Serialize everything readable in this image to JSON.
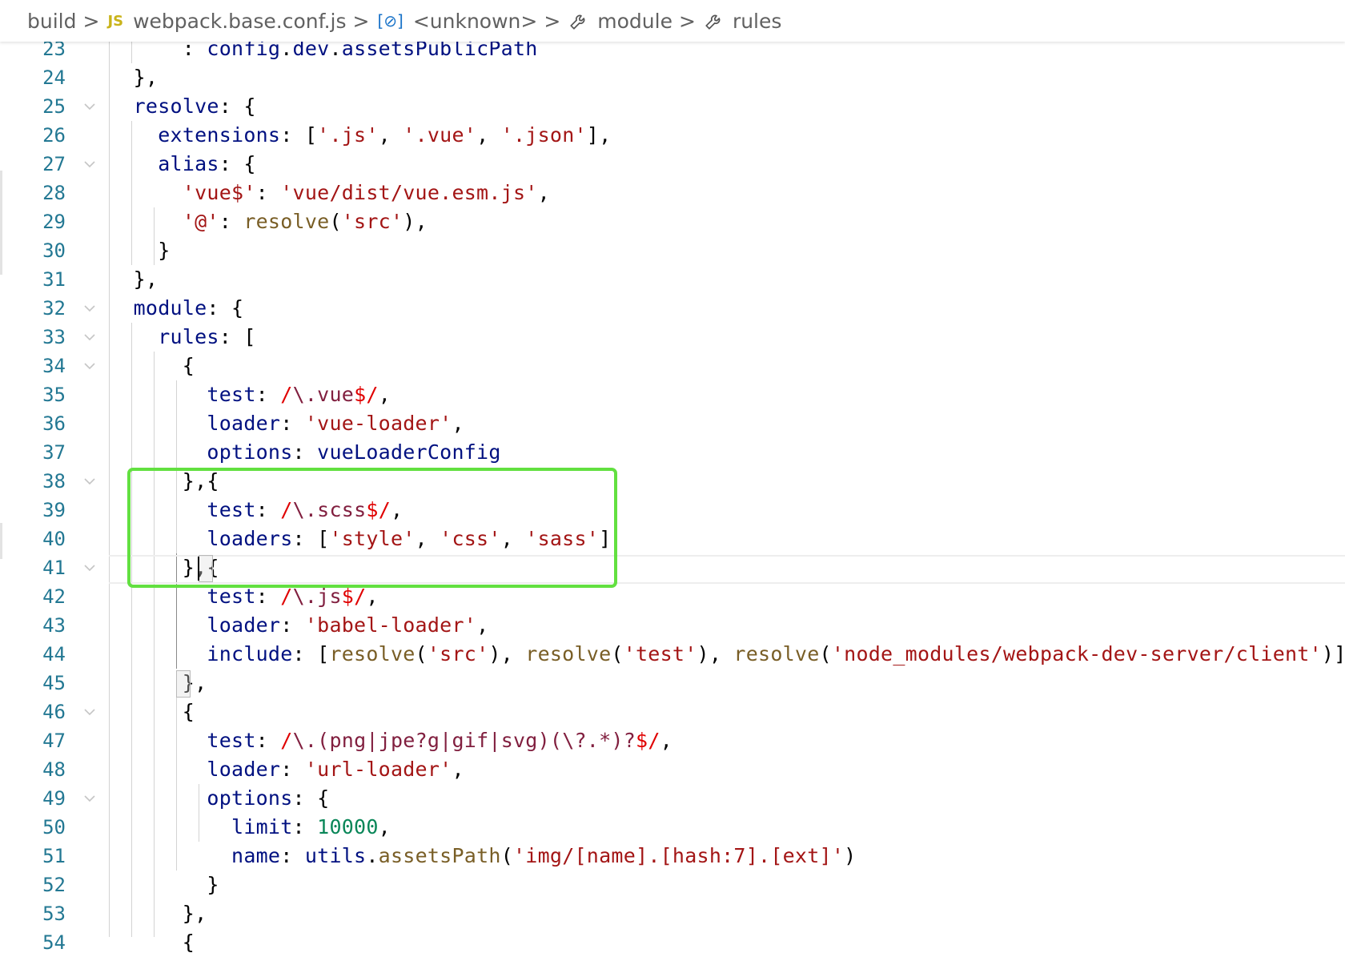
{
  "breadcrumb": {
    "items": [
      {
        "label": "build",
        "icon": ""
      },
      {
        "label": "webpack.base.conf.js",
        "icon": "JS"
      },
      {
        "label": "<unknown>",
        "icon": "symbol-variable"
      },
      {
        "label": "module",
        "icon": "wrench"
      },
      {
        "label": "rules",
        "icon": "wrench"
      }
    ],
    "separator": ">"
  },
  "colors": {
    "highlight_box": "#62e040",
    "line_number": "#237893",
    "keyword": "#001080",
    "string": "#a31515",
    "regex": "#811f3f"
  },
  "editor": {
    "lines": [
      {
        "n": "23",
        "fold": false
      },
      {
        "n": "24",
        "fold": false
      },
      {
        "n": "25",
        "fold": true
      },
      {
        "n": "26",
        "fold": false
      },
      {
        "n": "27",
        "fold": true
      },
      {
        "n": "28",
        "fold": false
      },
      {
        "n": "29",
        "fold": false
      },
      {
        "n": "30",
        "fold": false
      },
      {
        "n": "31",
        "fold": false
      },
      {
        "n": "32",
        "fold": true
      },
      {
        "n": "33",
        "fold": true
      },
      {
        "n": "34",
        "fold": true
      },
      {
        "n": "35",
        "fold": false
      },
      {
        "n": "36",
        "fold": false
      },
      {
        "n": "37",
        "fold": false
      },
      {
        "n": "38",
        "fold": true
      },
      {
        "n": "39",
        "fold": false
      },
      {
        "n": "40",
        "fold": false
      },
      {
        "n": "41",
        "fold": true
      },
      {
        "n": "42",
        "fold": false
      },
      {
        "n": "43",
        "fold": false
      },
      {
        "n": "44",
        "fold": false
      },
      {
        "n": "45",
        "fold": false
      },
      {
        "n": "46",
        "fold": true
      },
      {
        "n": "47",
        "fold": false
      },
      {
        "n": "48",
        "fold": false
      },
      {
        "n": "49",
        "fold": true
      },
      {
        "n": "50",
        "fold": false
      },
      {
        "n": "51",
        "fold": false
      },
      {
        "n": "52",
        "fold": false
      },
      {
        "n": "53",
        "fold": false
      },
      {
        "n": "54",
        "fold": false
      }
    ],
    "code": {
      "l23_a": "      : ",
      "l23_b": "config",
      "l23_c": ".",
      "l23_d": "dev",
      "l23_e": ".",
      "l23_f": "assetsPublicPath",
      "l24": "  },",
      "l25_a": "  ",
      "l25_b": "resolve",
      "l25_c": ": {",
      "l26_a": "    ",
      "l26_b": "extensions",
      "l26_c": ": [",
      "l26_d": "'.js'",
      "l26_e": ", ",
      "l26_f": "'.vue'",
      "l26_g": ", ",
      "l26_h": "'.json'",
      "l26_i": "],",
      "l27_a": "    ",
      "l27_b": "alias",
      "l27_c": ": {",
      "l28_a": "      ",
      "l28_b": "'vue$'",
      "l28_c": ": ",
      "l28_d": "'vue/dist/vue.esm.js'",
      "l28_e": ",",
      "l29_a": "      ",
      "l29_b": "'@'",
      "l29_c": ": ",
      "l29_d": "resolve",
      "l29_e": "(",
      "l29_f": "'src'",
      "l29_g": "),",
      "l30": "    }",
      "l31": "  },",
      "l32_a": "  ",
      "l32_b": "module",
      "l32_c": ": {",
      "l33_a": "    ",
      "l33_b": "rules",
      "l33_c": ": [",
      "l34": "      {",
      "l35_a": "        ",
      "l35_b": "test",
      "l35_c": ": ",
      "l35_d": "/",
      "l35_e": "\\.",
      "l35_f": "vue",
      "l35_g": "$/",
      "l35_h": ",",
      "l36_a": "        ",
      "l36_b": "loader",
      "l36_c": ": ",
      "l36_d": "'vue-loader'",
      "l36_e": ",",
      "l37_a": "        ",
      "l37_b": "options",
      "l37_c": ": ",
      "l37_d": "vueLoaderConfig",
      "l38": "      },{",
      "l39_a": "        ",
      "l39_b": "test",
      "l39_c": ": ",
      "l39_d": "/",
      "l39_e": "\\.",
      "l39_f": "scss",
      "l39_g": "$/",
      "l39_h": ",",
      "l40_a": "        ",
      "l40_b": "loaders",
      "l40_c": ": [",
      "l40_d": "'style'",
      "l40_e": ", ",
      "l40_f": "'css'",
      "l40_g": ", ",
      "l40_h": "'sass'",
      "l40_i": "]",
      "l41": "      },{",
      "l42_a": "        ",
      "l42_b": "test",
      "l42_c": ": ",
      "l42_d": "/",
      "l42_e": "\\.",
      "l42_f": "js",
      "l42_g": "$/",
      "l42_h": ",",
      "l43_a": "        ",
      "l43_b": "loader",
      "l43_c": ": ",
      "l43_d": "'babel-loader'",
      "l43_e": ",",
      "l44_a": "        ",
      "l44_b": "include",
      "l44_c": ": [",
      "l44_d": "resolve",
      "l44_e": "(",
      "l44_f": "'src'",
      "l44_g": "), ",
      "l44_h": "resolve",
      "l44_i": "(",
      "l44_j": "'test'",
      "l44_k": "), ",
      "l44_l": "resolve",
      "l44_m": "(",
      "l44_n": "'node_modules/webpack-dev-server/client'",
      "l44_o": ")]",
      "l45": "      },",
      "l46": "      {",
      "l47_a": "        ",
      "l47_b": "test",
      "l47_c": ": ",
      "l47_d": "/",
      "l47_e": "\\.",
      "l47_f": "(png|jpe?g|gif|svg)(\\?.*)?",
      "l47_g": "$/",
      "l47_h": ",",
      "l48_a": "        ",
      "l48_b": "loader",
      "l48_c": ": ",
      "l48_d": "'url-loader'",
      "l48_e": ",",
      "l49_a": "        ",
      "l49_b": "options",
      "l49_c": ": {",
      "l50_a": "          ",
      "l50_b": "limit",
      "l50_c": ": ",
      "l50_d": "10000",
      "l50_e": ",",
      "l51_a": "          ",
      "l51_b": "name",
      "l51_c": ": ",
      "l51_d": "utils",
      "l51_e": ".",
      "l51_f": "assetsPath",
      "l51_g": "(",
      "l51_h": "'img/[name].[hash:7].[ext]'",
      "l51_i": ")",
      "l52": "        }",
      "l53": "      },",
      "l54": "      {"
    }
  }
}
